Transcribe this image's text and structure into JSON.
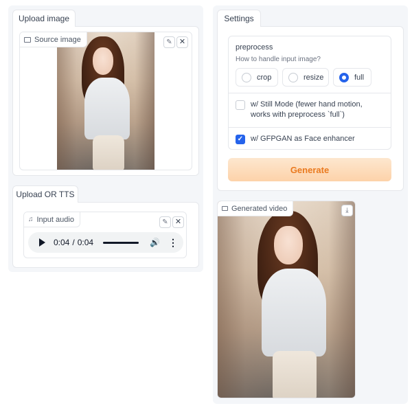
{
  "upload_image": {
    "tab_label": "Upload image",
    "source_image_label": "Source image",
    "edit_icon": "pencil-icon",
    "clear_icon": "close-icon"
  },
  "upload_tts": {
    "tab_label": "Upload OR TTS",
    "input_audio_label": "Input audio",
    "current_time": "0:04",
    "separator": "/",
    "duration": "0:04",
    "progress": 1.0
  },
  "settings": {
    "tab_label": "Settings",
    "preprocess": {
      "title": "preprocess",
      "info": "How to handle input image?",
      "options": [
        "crop",
        "resize",
        "full"
      ],
      "selected": "full"
    },
    "still_mode": {
      "label": "w/ Still Mode (fewer hand motion, works with preprocess `full`)",
      "checked": false
    },
    "gfpgan": {
      "label": "w/ GFPGAN as Face enhancer",
      "checked": true
    },
    "generate_label": "Generate"
  },
  "generated_video": {
    "label": "Generated video",
    "download_icon": "download-icon"
  },
  "colors": {
    "accent": "#2563eb",
    "generate_text": "#ea7a1f",
    "generate_bg": "#fdd2a9",
    "panel_bg": "#f4f6f9"
  }
}
